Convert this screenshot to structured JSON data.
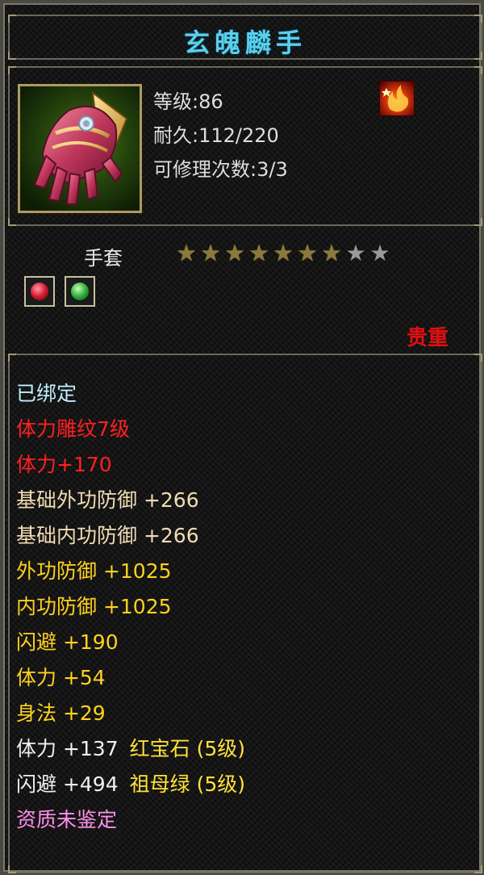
{
  "item": {
    "name": "玄魄麟手",
    "level_line": "等级:86",
    "durability_line": "耐久:112/220",
    "repair_line": "可修理次数:3/3",
    "slot": "手套",
    "stars_total": 10,
    "stars_lit": 7,
    "rarity": "贵重",
    "icon": "gauntlet-icon",
    "badge_icon": "flame-emblem-icon",
    "gem_slots": [
      {
        "icon": "ruby-gem-icon",
        "color": "#d81830"
      },
      {
        "icon": "emerald-gem-icon",
        "color": "#2fae3a"
      }
    ]
  },
  "attributes": [
    {
      "text": "已绑定",
      "color": "#bfeeff"
    },
    {
      "text": "体力雕纹7级",
      "color": "#ff2020"
    },
    {
      "text": "体力+170",
      "color": "#ff2020"
    },
    {
      "text": "基础外功防御  +266",
      "color": "#f2dcb4"
    },
    {
      "text": "基础内功防御  +266",
      "color": "#f2dcb4"
    },
    {
      "text": "外功防御  +1025",
      "color": "#ffd21e"
    },
    {
      "text": "内功防御  +1025",
      "color": "#ffd21e"
    },
    {
      "text": "闪避  +190",
      "color": "#ffd21e"
    },
    {
      "text": "体力  +54",
      "color": "#ffd21e"
    },
    {
      "text": "身法  +29",
      "color": "#ffd21e"
    },
    {
      "text": "体力  +137",
      "gem": "红宝石 (5级)",
      "color": "#f0f0f0",
      "gem_color": "#ffe23a"
    },
    {
      "text": "闪避  +494",
      "gem": "祖母绿 (5级)",
      "color": "#f0f0f0",
      "gem_color": "#ffe23a"
    },
    {
      "text": "资质未鉴定",
      "color": "#ff90e8"
    }
  ],
  "colors": {
    "title": "#58d0ee",
    "rarity": "#e01010",
    "border": "#6b675a"
  }
}
